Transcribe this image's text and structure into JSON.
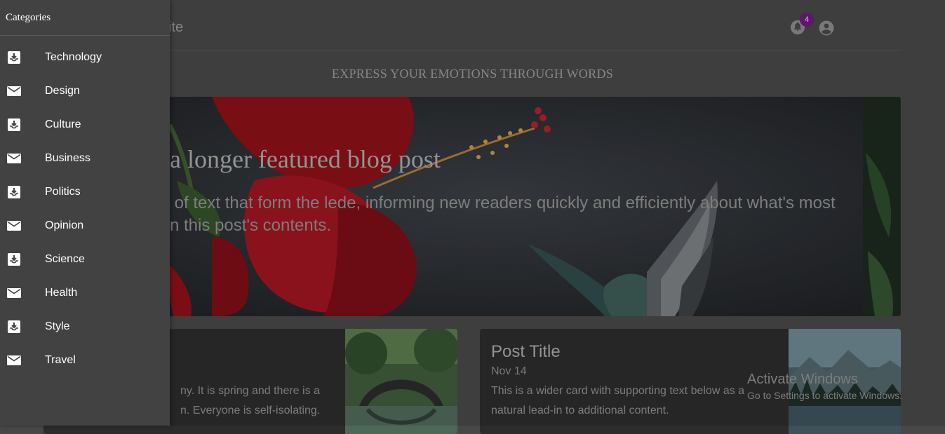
{
  "header": {
    "site_title": "site",
    "notification_count": "4"
  },
  "tagline": "EXPRESS YOUR EMOTIONS THROUGH WORDS",
  "hero": {
    "title": "a longer featured blog post",
    "lede_line1": "s of text that form the lede, informing new readers quickly and efficiently about what's most",
    "lede_line2": "n this post's contents."
  },
  "cards": [
    {
      "text_line1": "ny. It is spring and there is a",
      "text_line2": "n. Everyone is self-isolating."
    },
    {
      "title": "Post Title",
      "date": "Nov 14",
      "text_line1": "This is a wider card with supporting text below as a",
      "text_line2": "natural lead-in to additional content."
    }
  ],
  "drawer": {
    "title": "Categories",
    "items": [
      {
        "label": "Technology",
        "icon": "move-to-inbox-icon"
      },
      {
        "label": "Design",
        "icon": "mail-icon"
      },
      {
        "label": "Culture",
        "icon": "move-to-inbox-icon"
      },
      {
        "label": "Business",
        "icon": "mail-icon"
      },
      {
        "label": "Politics",
        "icon": "move-to-inbox-icon"
      },
      {
        "label": "Opinion",
        "icon": "mail-icon"
      },
      {
        "label": "Science",
        "icon": "move-to-inbox-icon"
      },
      {
        "label": "Health",
        "icon": "mail-icon"
      },
      {
        "label": "Style",
        "icon": "move-to-inbox-icon"
      },
      {
        "label": "Travel",
        "icon": "mail-icon"
      }
    ]
  },
  "watermark": {
    "title": "Activate Windows",
    "subtitle": "Go to Settings to activate Windows."
  },
  "colors": {
    "badge": "#6a1b7a",
    "drawer_bg": "#424242",
    "page_bg": "#474747"
  }
}
